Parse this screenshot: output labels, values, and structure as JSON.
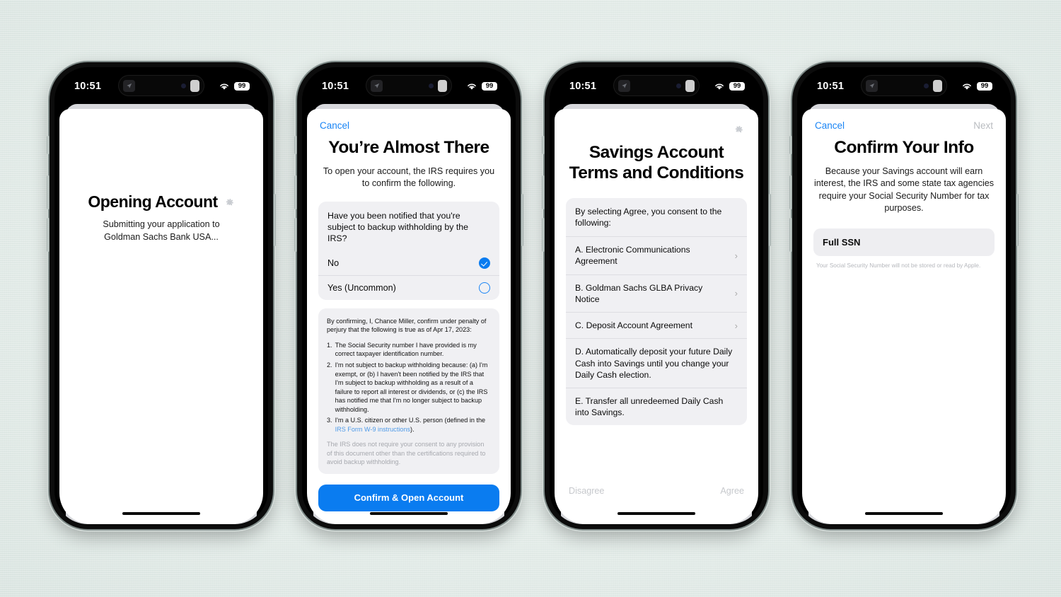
{
  "background": {
    "color": "#e3ece9"
  },
  "status_bar": {
    "time": "10:51",
    "battery": "99",
    "wifi_icon": "wifi-icon",
    "island_app_icon": "app-icon",
    "island_pill_icon": "recording-indicator"
  },
  "phones": [
    {
      "id": "phone-opening-account",
      "screen": {
        "title": "Opening Account",
        "spinner_icon": "loading-spinner-icon",
        "subtitle": "Submitting your application to Goldman Sachs Bank USA..."
      }
    },
    {
      "id": "phone-almost-there",
      "screen": {
        "nav": {
          "cancel": "Cancel"
        },
        "title": "You’re Almost There",
        "subtitle": "To open your account, the IRS requires you to confirm the following.",
        "question_card": {
          "question": "Have you been notified that you're subject to backup withholding by the IRS?",
          "options": [
            {
              "label": "No",
              "selected": true
            },
            {
              "label": "Yes (Uncommon)",
              "selected": false
            }
          ]
        },
        "legal": {
          "intro": "By confirming, I, Chance Miller, confirm under penalty of perjury that the following is true as of Apr 17, 2023:",
          "items": [
            {
              "num": "1.",
              "text": "The Social Security number I have provided is my correct taxpayer identification number."
            },
            {
              "num": "2.",
              "text": "I'm not subject to backup withholding because: (a) I'm exempt, or (b) I haven't been notified by the IRS that I'm subject to backup withholding as a result of a failure to report all interest or dividends, or (c) the IRS has notified me that I'm no longer subject to backup withholding."
            },
            {
              "num": "3.",
              "text_before": "I'm a U.S. citizen or other U.S. person (defined in the ",
              "link": "IRS Form W-9 instructions",
              "text_after": ")."
            }
          ],
          "footer": "The IRS does not require your consent to any provision of this document other than the certifications required to avoid backup withholding."
        },
        "primary_button": "Confirm & Open Account"
      }
    },
    {
      "id": "phone-terms-conditions",
      "screen": {
        "spinner_icon": "loading-spinner-icon",
        "title_line1": "Savings Account",
        "title_line2": "Terms and Conditions",
        "consent_header": "By selecting Agree, you consent to the following:",
        "items": [
          {
            "label": "A. Electronic Communications Agreement",
            "has_chevron": true
          },
          {
            "label": "B. Goldman Sachs GLBA Privacy Notice",
            "has_chevron": true
          },
          {
            "label": "C. Deposit Account Agreement",
            "has_chevron": true
          },
          {
            "label": "D. Automatically deposit your future Daily Cash into Savings until you change your Daily Cash election.",
            "has_chevron": false
          },
          {
            "label": "E. Transfer all unredeemed Daily Cash into Savings.",
            "has_chevron": false
          }
        ],
        "actions": {
          "disagree": "Disagree",
          "agree": "Agree"
        }
      }
    },
    {
      "id": "phone-confirm-info",
      "screen": {
        "nav": {
          "cancel": "Cancel",
          "next": "Next"
        },
        "title": "Confirm Your Info",
        "subtitle": "Because your Savings account will earn interest, the IRS and some state tax agencies require your Social Security Number for tax purposes.",
        "field": {
          "label": "Full SSN",
          "value": ""
        },
        "note": "Your Social Security Number will not be stored or read by Apple."
      }
    }
  ],
  "colors": {
    "accent_blue": "#0a7cf0",
    "link_blue": "#1a85f5",
    "card_gray": "#f0f0f3",
    "muted_text": "#b5b7bc"
  }
}
